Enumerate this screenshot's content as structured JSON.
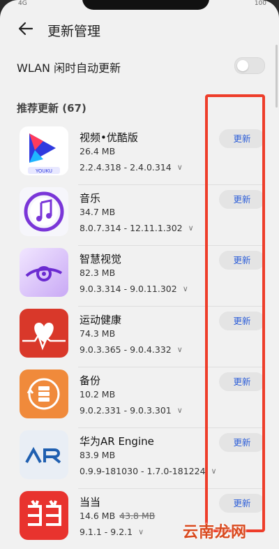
{
  "status": {
    "left": "4G",
    "right": "100"
  },
  "header": {
    "title": "更新管理"
  },
  "wlan": {
    "label": "WLAN 闲时自动更新",
    "enabled": false
  },
  "section": {
    "title": "推荐更新 (67)"
  },
  "apps": [
    {
      "name": "视频•优酷版",
      "size": "26.4 MB",
      "version": "2.2.4.318 - 2.4.0.314",
      "update_label": "更新",
      "icon": "youku-icon"
    },
    {
      "name": "音乐",
      "size": "34.7 MB",
      "version": "8.0.7.314 - 12.11.1.302",
      "update_label": "更新",
      "icon": "music-icon"
    },
    {
      "name": "智慧视觉",
      "size": "82.3 MB",
      "version": "9.0.3.314 - 9.0.11.302",
      "update_label": "更新",
      "icon": "vision-icon"
    },
    {
      "name": "运动健康",
      "size": "74.3 MB",
      "version": "9.0.3.365 - 9.0.4.332",
      "update_label": "更新",
      "icon": "health-icon"
    },
    {
      "name": "备份",
      "size": "10.2 MB",
      "version": "9.0.2.331 - 9.0.3.301",
      "update_label": "更新",
      "icon": "backup-icon"
    },
    {
      "name": "华为AR Engine",
      "size": "83.9 MB",
      "version": "0.9.9-181030 - 1.7.0-181224",
      "update_label": "更新",
      "icon": "ar-icon"
    },
    {
      "name": "当当",
      "size": "14.6 MB",
      "size_old": "43.8 MB",
      "version": "9.1.1 - 9.2.1",
      "update_label": "更新",
      "icon": "dangdang-icon"
    }
  ],
  "watermark": {
    "text": "云南龙网"
  },
  "colors": {
    "accent": "#2b5dd8",
    "highlight": "#ee3d2a",
    "watermark": "#d94a1f"
  }
}
